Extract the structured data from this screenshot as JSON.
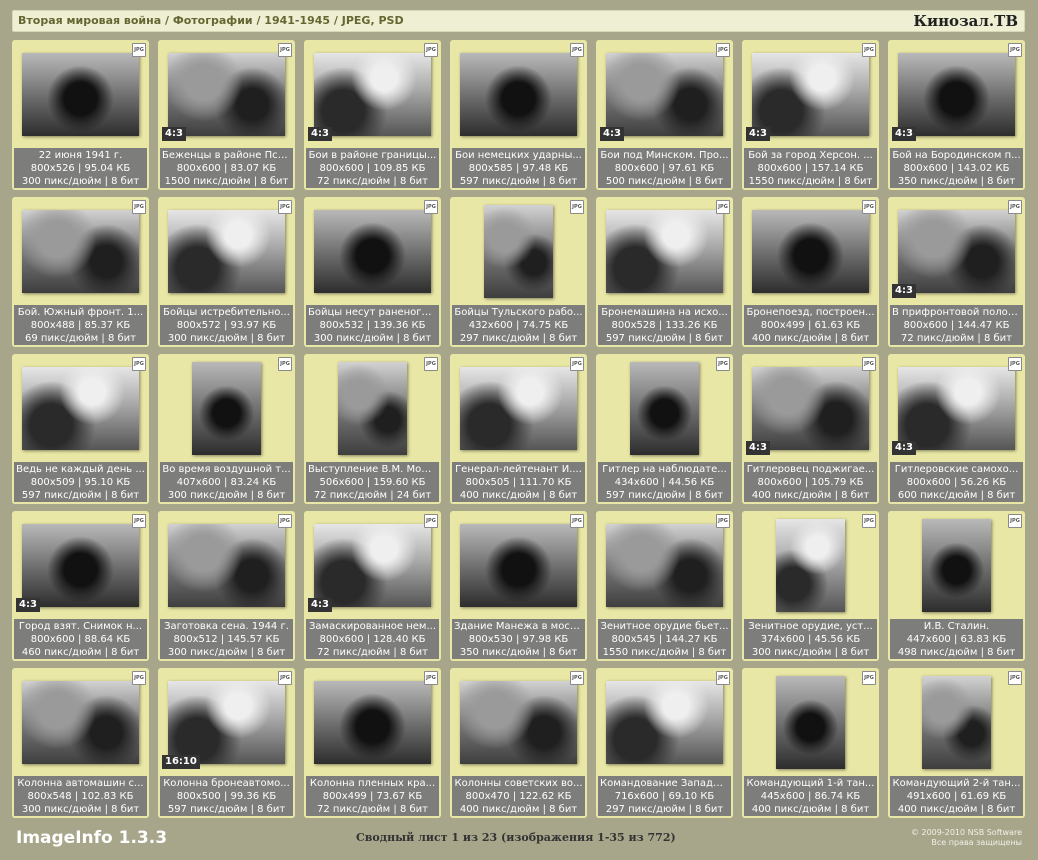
{
  "header": {
    "breadcrumb": "Вторая мировая война / Фотографии / 1941-1945 / JPEG, PSD",
    "brand": "Кинозал.TB"
  },
  "jpg_badge": "JPG",
  "items": [
    {
      "caption": "22 июня 1941 г.",
      "dims": "800x526 | 95.04 КБ",
      "meta": "300 пикс/дюйм | 8 бит",
      "ratio": "",
      "orientation": "landscape"
    },
    {
      "caption": "Беженцы в районе Пск...",
      "dims": "800x600 | 83.07 КБ",
      "meta": "1500 пикс/дюйм | 8 бит",
      "ratio": "4:3",
      "orientation": "landscape"
    },
    {
      "caption": "Бои в районе границы...",
      "dims": "800x600 | 109.85 КБ",
      "meta": "72 пикс/дюйм | 8 бит",
      "ratio": "4:3",
      "orientation": "landscape"
    },
    {
      "caption": "Бои немецких ударны...",
      "dims": "800x585 | 97.48 КБ",
      "meta": "597 пикс/дюйм | 8 бит",
      "ratio": "",
      "orientation": "landscape"
    },
    {
      "caption": "Бои под Минском. Про...",
      "dims": "800x600 | 97.61 КБ",
      "meta": "500 пикс/дюйм | 8 бит",
      "ratio": "4:3",
      "orientation": "landscape"
    },
    {
      "caption": "Бой за город Херсон. ...",
      "dims": "800x600 | 157.14 КБ",
      "meta": "1550 пикс/дюйм | 8 бит",
      "ratio": "4:3",
      "orientation": "landscape"
    },
    {
      "caption": "Бой на Бородинском п...",
      "dims": "800x600 | 143.02 КБ",
      "meta": "350 пикс/дюйм | 8 бит",
      "ratio": "4:3",
      "orientation": "landscape"
    },
    {
      "caption": "Бой. Южный фронт. 1...",
      "dims": "800x488 | 85.37 КБ",
      "meta": "69 пикс/дюйм | 8 бит",
      "ratio": "",
      "orientation": "landscape"
    },
    {
      "caption": "Бойцы истребительно...",
      "dims": "800x572 | 93.97 КБ",
      "meta": "300 пикс/дюйм | 8 бит",
      "ratio": "",
      "orientation": "landscape"
    },
    {
      "caption": "Бойцы несут раненого...",
      "dims": "800x532 | 139.36 КБ",
      "meta": "300 пикс/дюйм | 8 бит",
      "ratio": "",
      "orientation": "landscape"
    },
    {
      "caption": "Бойцы Тульского рабо...",
      "dims": "432x600 | 74.75 КБ",
      "meta": "297 пикс/дюйм | 8 бит",
      "ratio": "",
      "orientation": "portrait"
    },
    {
      "caption": "Бронемашина на исхо...",
      "dims": "800x528 | 133.26 КБ",
      "meta": "597 пикс/дюйм | 8 бит",
      "ratio": "",
      "orientation": "landscape"
    },
    {
      "caption": "Бронепоезд, построен...",
      "dims": "800x499 | 61.63 КБ",
      "meta": "400 пикс/дюйм | 8 бит",
      "ratio": "",
      "orientation": "landscape"
    },
    {
      "caption": "В прифронтовой полос...",
      "dims": "800x600 | 144.47 КБ",
      "meta": "72 пикс/дюйм | 8 бит",
      "ratio": "4:3",
      "orientation": "landscape"
    },
    {
      "caption": "Ведь не каждый день ...",
      "dims": "800x509 | 95.10 КБ",
      "meta": "597 пикс/дюйм | 8 бит",
      "ratio": "",
      "orientation": "landscape"
    },
    {
      "caption": "Во время воздушной т...",
      "dims": "407x600 | 83.24 КБ",
      "meta": "300 пикс/дюйм | 8 бит",
      "ratio": "",
      "orientation": "portrait"
    },
    {
      "caption": "Выступление В.М. Мол...",
      "dims": "506x600 | 159.60 КБ",
      "meta": "72 пикс/дюйм | 24 бит",
      "ratio": "",
      "orientation": "portrait"
    },
    {
      "caption": "Генерал-лейтенант И....",
      "dims": "800x505 | 111.70 КБ",
      "meta": "400 пикс/дюйм | 8 бит",
      "ratio": "",
      "orientation": "landscape"
    },
    {
      "caption": "Гитлер на наблюдате...",
      "dims": "434x600 | 44.56 КБ",
      "meta": "597 пикс/дюйм | 8 бит",
      "ratio": "",
      "orientation": "portrait"
    },
    {
      "caption": "Гитлеровец поджигае...",
      "dims": "800x600 | 105.79 КБ",
      "meta": "400 пикс/дюйм | 8 бит",
      "ratio": "4:3",
      "orientation": "landscape"
    },
    {
      "caption": "Гитлеровские самохо...",
      "dims": "800x600 | 56.26 КБ",
      "meta": "600 пикс/дюйм | 8 бит",
      "ratio": "4:3",
      "orientation": "landscape"
    },
    {
      "caption": "Город взят. Снимок н...",
      "dims": "800x600 | 88.64 КБ",
      "meta": "460 пикс/дюйм | 8 бит",
      "ratio": "4:3",
      "orientation": "landscape"
    },
    {
      "caption": "Заготовка сена. 1944 г.",
      "dims": "800x512 | 145.57 КБ",
      "meta": "300 пикс/дюйм | 8 бит",
      "ratio": "",
      "orientation": "landscape"
    },
    {
      "caption": "Замаскированное нем...",
      "dims": "800x600 | 128.40 КБ",
      "meta": "72 пикс/дюйм | 8 бит",
      "ratio": "4:3",
      "orientation": "landscape"
    },
    {
      "caption": "Здание Манежа в моск...",
      "dims": "800x530 | 97.98 КБ",
      "meta": "350 пикс/дюйм | 8 бит",
      "ratio": "",
      "orientation": "landscape"
    },
    {
      "caption": "Зенитное орудие бьет...",
      "dims": "800x545 | 144.27 КБ",
      "meta": "1550 пикс/дюйм | 8 бит",
      "ratio": "",
      "orientation": "landscape"
    },
    {
      "caption": "Зенитное орудие, уст...",
      "dims": "374x600 | 45.56 КБ",
      "meta": "300 пикс/дюйм | 8 бит",
      "ratio": "",
      "orientation": "portrait"
    },
    {
      "caption": "И.В. Сталин.",
      "dims": "447x600 | 63.83 КБ",
      "meta": "498 пикс/дюйм | 8 бит",
      "ratio": "",
      "orientation": "portrait"
    },
    {
      "caption": "Колонна автомашин с...",
      "dims": "800x548 | 102.83 КБ",
      "meta": "300 пикс/дюйм | 8 бит",
      "ratio": "",
      "orientation": "landscape"
    },
    {
      "caption": "Колонна бронеавтомо...",
      "dims": "800x500 | 99.36 КБ",
      "meta": "597 пикс/дюйм | 8 бит",
      "ratio": "16:10",
      "orientation": "landscape"
    },
    {
      "caption": "Колонна пленных кра...",
      "dims": "800x499 | 73.67 КБ",
      "meta": "72 пикс/дюйм | 8 бит",
      "ratio": "",
      "orientation": "landscape"
    },
    {
      "caption": "Колонны советских во...",
      "dims": "800x470 | 122.62 КБ",
      "meta": "400 пикс/дюйм | 8 бит",
      "ratio": "",
      "orientation": "landscape"
    },
    {
      "caption": "Командование Западн...",
      "dims": "716x600 | 69.10 КБ",
      "meta": "297 пикс/дюйм | 8 бит",
      "ratio": "",
      "orientation": "landscape"
    },
    {
      "caption": "Командующий 1-й тан...",
      "dims": "445x600 | 86.74 КБ",
      "meta": "400 пикс/дюйм | 8 бит",
      "ratio": "",
      "orientation": "portrait"
    },
    {
      "caption": "Командующий 2-й тан...",
      "dims": "491x600 | 61.69 КБ",
      "meta": "400 пикс/дюйм | 8 бит",
      "ratio": "",
      "orientation": "portrait"
    }
  ],
  "footer": {
    "app_name": "ImageInfo 1.3.3",
    "page_info": "Сводный лист 1 из 23 (изображения 1-35 из 772)",
    "copyright": "© 2009-2010 NSB Software",
    "rights": "Все права защищены"
  }
}
